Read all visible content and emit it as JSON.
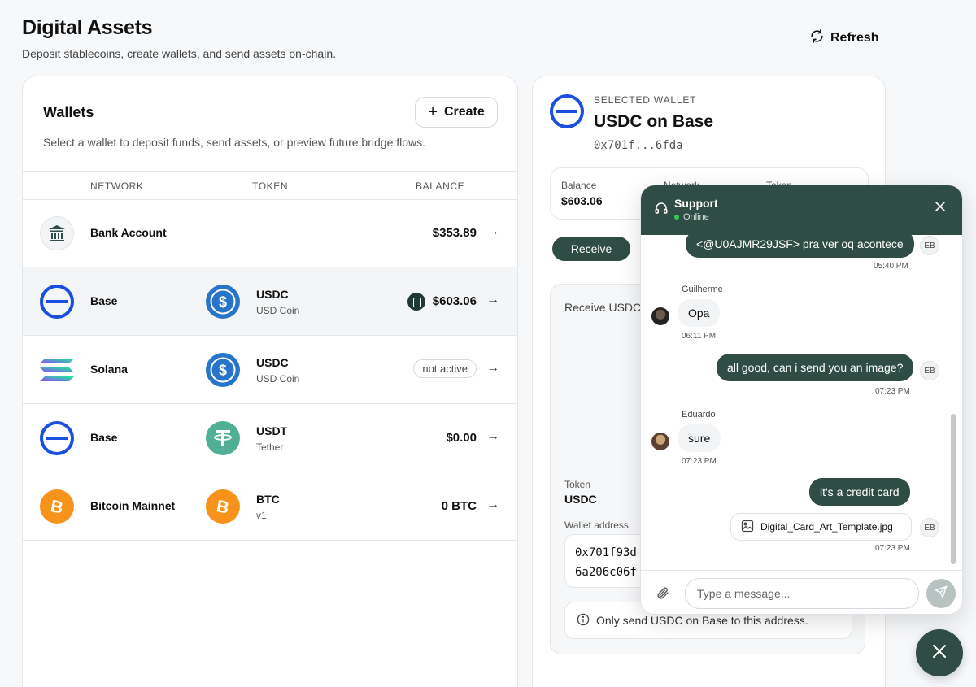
{
  "header": {
    "title": "Digital Assets",
    "subtitle": "Deposit stablecoins, create wallets, and send assets on-chain.",
    "refresh_label": "Refresh"
  },
  "wallets": {
    "title": "Wallets",
    "create_label": "Create",
    "description": "Select a wallet to deposit funds, send assets, or preview future bridge flows.",
    "columns": [
      "NETWORK",
      "TOKEN",
      "BALANCE"
    ],
    "rows": [
      {
        "network": "Bank Account",
        "network_icon": "bank-icon",
        "token_symbol": "",
        "token_name": "",
        "token_icon": "",
        "balance": "$353.89",
        "status": ""
      },
      {
        "network": "Base",
        "network_icon": "base-icon",
        "token_symbol": "USDC",
        "token_name": "USD Coin",
        "token_icon": "usdc-icon",
        "balance": "$603.06",
        "status": "",
        "selected": true
      },
      {
        "network": "Solana",
        "network_icon": "solana-icon",
        "token_symbol": "USDC",
        "token_name": "USD Coin",
        "token_icon": "usdc-icon",
        "balance": "",
        "status": "not active"
      },
      {
        "network": "Base",
        "network_icon": "base-icon",
        "token_symbol": "USDT",
        "token_name": "Tether",
        "token_icon": "tether-icon",
        "balance": "$0.00",
        "status": ""
      },
      {
        "network": "Bitcoin Mainnet",
        "network_icon": "bitcoin-icon",
        "token_symbol": "BTC",
        "token_name": "v1",
        "token_icon": "bitcoin-icon",
        "balance": "0 BTC",
        "status": ""
      }
    ]
  },
  "selected_wallet": {
    "label": "SELECTED WALLET",
    "title": "USDC on Base",
    "address_short": "0x701f...6fda",
    "stats": {
      "balance_label": "Balance",
      "balance_value": "$603.06",
      "network_label": "Network",
      "token_label": "Token"
    },
    "tab_receive": "Receive",
    "receive_title": "Receive USDC",
    "token_label": "Token",
    "token_value": "USDC",
    "wallet_address_label": "Wallet address",
    "address_line1": "0x701f93d",
    "address_line2": "6a206c06f",
    "warning": "Only send USDC on Base to this address."
  },
  "chat": {
    "title": "Support",
    "status": "Online",
    "messages": [
      {
        "text": "<@U0AJMR29JSF> pra ver oq acontece",
        "time": "05:40 PM",
        "initials": "EB"
      },
      {
        "sender": "Guilherme",
        "text": "Opa",
        "time": "06:11 PM"
      },
      {
        "text": "all good, can i send you an image?",
        "time": "07:23 PM",
        "initials": "EB"
      },
      {
        "sender": "Eduardo",
        "text": "sure",
        "time": "07:23 PM"
      },
      {
        "text": "it's a credit card",
        "time": "",
        "initials": ""
      },
      {
        "file": "Digital_Card_Art_Template.jpg",
        "time": "07:23 PM",
        "initials": "EB"
      }
    ],
    "input_placeholder": "Type a message..."
  },
  "colors": {
    "accent": "#2f4d45",
    "base_blue": "#1b4fe0",
    "usdc_blue": "#2775ca",
    "tether_green": "#50af95",
    "bitcoin_orange": "#f7931a"
  }
}
